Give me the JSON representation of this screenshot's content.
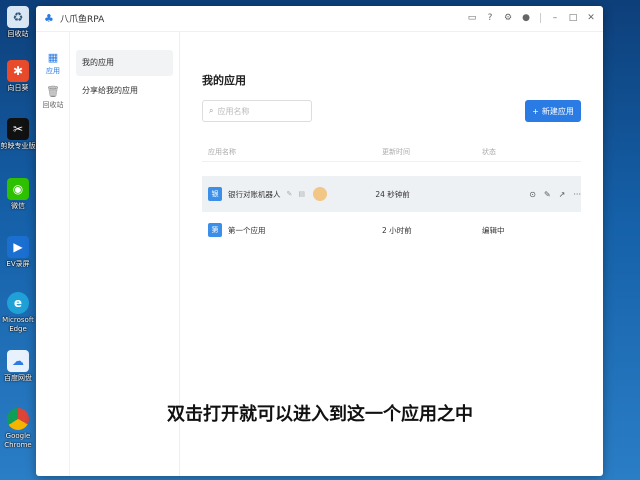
{
  "desktop": {
    "icons": [
      {
        "label": "回收站",
        "icon": "recycle-bin-icon"
      },
      {
        "label": "向日葵",
        "icon": "sunflower-icon"
      },
      {
        "label": "剪映专业版",
        "icon": "capcut-icon"
      },
      {
        "label": "微信",
        "icon": "wechat-icon"
      },
      {
        "label": "EV录屏",
        "icon": "ev-recorder-icon"
      },
      {
        "label": "Microsoft Edge",
        "icon": "edge-icon"
      },
      {
        "label": "百度网盘",
        "icon": "baidu-netdisk-icon"
      },
      {
        "label": "Google Chrome",
        "icon": "chrome-icon"
      }
    ]
  },
  "window": {
    "title": "八爪鱼RPA",
    "accent": "#2a7be4"
  },
  "rail": {
    "items": [
      {
        "label": "应用",
        "icon": "apps-grid-icon"
      },
      {
        "label": "回收站",
        "icon": "trash-icon"
      }
    ]
  },
  "subnav": {
    "items": [
      {
        "label": "我的应用"
      },
      {
        "label": "分享给我的应用"
      }
    ]
  },
  "main": {
    "title": "我的应用",
    "search_placeholder": "应用名称",
    "new_button": "新建应用",
    "columns": [
      "应用名称",
      "更新时间",
      "状态"
    ],
    "rows": [
      {
        "avatar": "银",
        "name": "银行对账机器人",
        "updated": "24 秒钟前",
        "status": ""
      },
      {
        "avatar": "第",
        "name": "第一个应用",
        "updated": "2 小时前",
        "status": "编辑中"
      }
    ]
  },
  "subtitle": "双击打开就可以进入到这一个应用之中"
}
